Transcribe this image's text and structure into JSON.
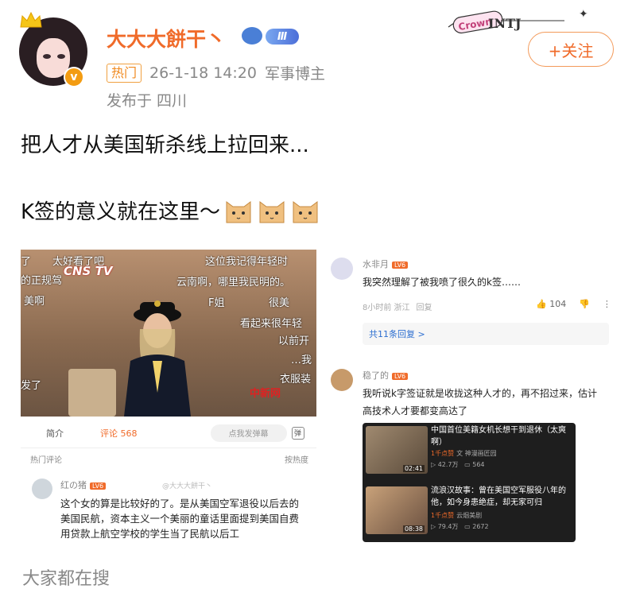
{
  "post": {
    "username": "大大大餅干丶",
    "level_badge": "Ⅲ",
    "hot_tag": "热门",
    "datetime": "26-1-18 14:20",
    "role": "军事博主",
    "location": "发布于 四川",
    "mbti": "INTJ",
    "deco_text": "Crown",
    "follow_label": "+关注",
    "text_line1": "把人才从美国斩杀线上拉回来...",
    "text_line2": "K签的意义就在这里～",
    "emoji_count": 3,
    "bottom_label": "大家都在搜"
  },
  "left_shot": {
    "channel": "CNS TV",
    "watermark": "中新网",
    "danmaku": [
      "了",
      "太好看了吧",
      "的正规驾",
      "美啊",
      "这位我记得年轻时",
      "云南啊，哪里我民明的。",
      "F姐",
      "很美",
      "看起来很年轻",
      "以前开",
      "…我",
      "衣服装",
      "发了"
    ],
    "tabs": {
      "intro": "简介",
      "comments": "评论 568",
      "danmu_placeholder": "点我发弹幕",
      "danmu_toggle": "弹"
    },
    "hot_comments": "热门评论",
    "sort_label": "按热度",
    "comment": {
      "name": "红の猪",
      "level": "LV6",
      "text": "这个女的算是比较好的了。是从美国空军退役以后去的美国民航，资本主义一个美丽的童话里面提到美国自费用贷款上航空学校的学生当了民航以后工",
      "watermark": "@大大大餅干丶"
    }
  },
  "right_shot": {
    "c1": {
      "name": "水非月",
      "level": "LV6",
      "text": "我突然理解了被我喷了很久的k签……",
      "time": "8小时前 浙江",
      "reply": "回复",
      "likes": "104"
    },
    "replies": "共11条回复 >",
    "c2": {
      "name": "稳了的",
      "level": "LV6",
      "text": "我听说k字签证就是收拢这种人才的，再不招过来，估计高技术人才要都变高达了"
    },
    "feed": [
      {
        "title": "中国首位美籍女机长想干到退休（太爽啊）",
        "tag": "1千点赞",
        "source": "文 神漫画匠园",
        "views": "42.7万",
        "danmaku": "564",
        "duration": "02:41"
      },
      {
        "title": "流浪汉故事：曾在美国空军服役八年的他，如今身患绝症，却无家可归",
        "tag": "1千点赞",
        "source": "云烟美剧",
        "views": "79.4万",
        "danmaku": "2672",
        "duration": "08:38"
      }
    ]
  },
  "colors": {
    "accent": "#f06b2a",
    "link": "#2d6fd0"
  }
}
